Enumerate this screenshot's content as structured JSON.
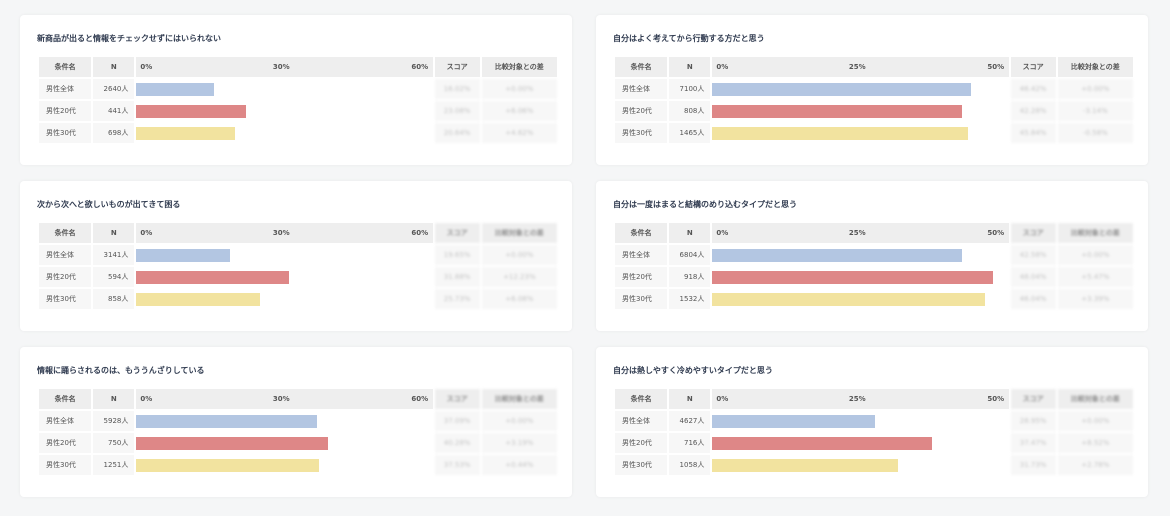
{
  "headers": {
    "condition": "条件名",
    "n": "N",
    "score": "スコア",
    "diff": "比較対象との差"
  },
  "legend_colors": {
    "男性全体": "#b3c6e2",
    "男性20代": "#de8787",
    "男性30代": "#f2e39f"
  },
  "cards": [
    {
      "title": "新商品が出ると情報をチェックせずにはいられない",
      "ticks": [
        "0%",
        "30%",
        "60%"
      ],
      "rows": [
        {
          "label": "男性全体",
          "n": "2640人",
          "score": "16.02%",
          "diff": "+0.00%"
        },
        {
          "label": "男性20代",
          "n": "441人",
          "score": "23.08%",
          "diff": "+6.06%"
        },
        {
          "label": "男性30代",
          "n": "698人",
          "score": "20.64%",
          "diff": "+4.62%"
        }
      ]
    },
    {
      "title": "自分はよく考えてから行動する方だと思う",
      "ticks": [
        "0%",
        "25%",
        "50%"
      ],
      "rows": [
        {
          "label": "男性全体",
          "n": "7100人",
          "score": "46.42%",
          "diff": "+0.00%"
        },
        {
          "label": "男性20代",
          "n": "808人",
          "score": "42.28%",
          "diff": "-3.14%"
        },
        {
          "label": "男性30代",
          "n": "1465人",
          "score": "45.84%",
          "diff": "-0.58%"
        }
      ]
    },
    {
      "title": "次から次へと欲しいものが出てきて困る",
      "ticks": [
        "0%",
        "30%",
        "60%"
      ],
      "rows": [
        {
          "label": "男性全体",
          "n": "3141人",
          "score": "19.65%",
          "diff": "+0.00%"
        },
        {
          "label": "男性20代",
          "n": "594人",
          "score": "31.88%",
          "diff": "+12.23%"
        },
        {
          "label": "男性30代",
          "n": "858人",
          "score": "25.73%",
          "diff": "+6.08%"
        }
      ]
    },
    {
      "title": "自分は一度はまると結構のめり込むタイプだと思う",
      "ticks": [
        "0%",
        "25%",
        "50%"
      ],
      "rows": [
        {
          "label": "男性全体",
          "n": "6804人",
          "score": "42.58%",
          "diff": "+0.00%"
        },
        {
          "label": "男性20代",
          "n": "918人",
          "score": "48.04%",
          "diff": "+5.47%"
        },
        {
          "label": "男性30代",
          "n": "1532人",
          "score": "46.04%",
          "diff": "+3.39%"
        }
      ]
    },
    {
      "title": "情報に踊らされるのは、もううんざりしている",
      "ticks": [
        "0%",
        "30%",
        "60%"
      ],
      "rows": [
        {
          "label": "男性全体",
          "n": "5928人",
          "score": "37.09%",
          "diff": "+0.00%"
        },
        {
          "label": "男性20代",
          "n": "750人",
          "score": "40.28%",
          "diff": "+3.19%"
        },
        {
          "label": "男性30代",
          "n": "1251人",
          "score": "37.53%",
          "diff": "+0.44%"
        }
      ]
    },
    {
      "title": "自分は熱しやすく冷めやすいタイプだと思う",
      "ticks": [
        "0%",
        "25%",
        "50%"
      ],
      "rows": [
        {
          "label": "男性全体",
          "n": "4627人",
          "score": "28.95%",
          "diff": "+0.00%"
        },
        {
          "label": "男性20代",
          "n": "716人",
          "score": "37.47%",
          "diff": "+8.52%"
        },
        {
          "label": "男性30代",
          "n": "1058人",
          "score": "31.73%",
          "diff": "+2.78%"
        }
      ]
    }
  ],
  "chart_data": [
    {
      "type": "bar",
      "title": "新商品が出ると情報をチェックせずにはいられない",
      "xlim": [
        0,
        60
      ],
      "categories": [
        "男性全体",
        "男性20代",
        "男性30代"
      ],
      "values": [
        16.5,
        23.5,
        21.0
      ]
    },
    {
      "type": "bar",
      "title": "自分はよく考えてから行動する方だと思う",
      "xlim": [
        0,
        50
      ],
      "categories": [
        "男性全体",
        "男性20代",
        "男性30代"
      ],
      "values": [
        46.0,
        44.5,
        45.5
      ]
    },
    {
      "type": "bar",
      "title": "次から次へと欲しいものが出てきて困る",
      "xlim": [
        0,
        60
      ],
      "categories": [
        "男性全体",
        "男性20代",
        "男性30代"
      ],
      "values": [
        20.0,
        32.5,
        26.5
      ]
    },
    {
      "type": "bar",
      "title": "自分は一度はまると結構のめり込むタイプだと思う",
      "xlim": [
        0,
        50
      ],
      "categories": [
        "男性全体",
        "男性20代",
        "男性30代"
      ],
      "values": [
        44.5,
        50.0,
        48.5
      ]
    },
    {
      "type": "bar",
      "title": "情報に踊らされるのは、もううんざりしている",
      "xlim": [
        0,
        60
      ],
      "categories": [
        "男性全体",
        "男性20代",
        "男性30代"
      ],
      "values": [
        38.5,
        41.0,
        39.0
      ]
    },
    {
      "type": "bar",
      "title": "自分は熱しやすく冷めやすいタイプだと思う",
      "xlim": [
        0,
        50
      ],
      "categories": [
        "男性全体",
        "男性20代",
        "男性30代"
      ],
      "values": [
        29.0,
        39.0,
        33.0
      ]
    }
  ]
}
